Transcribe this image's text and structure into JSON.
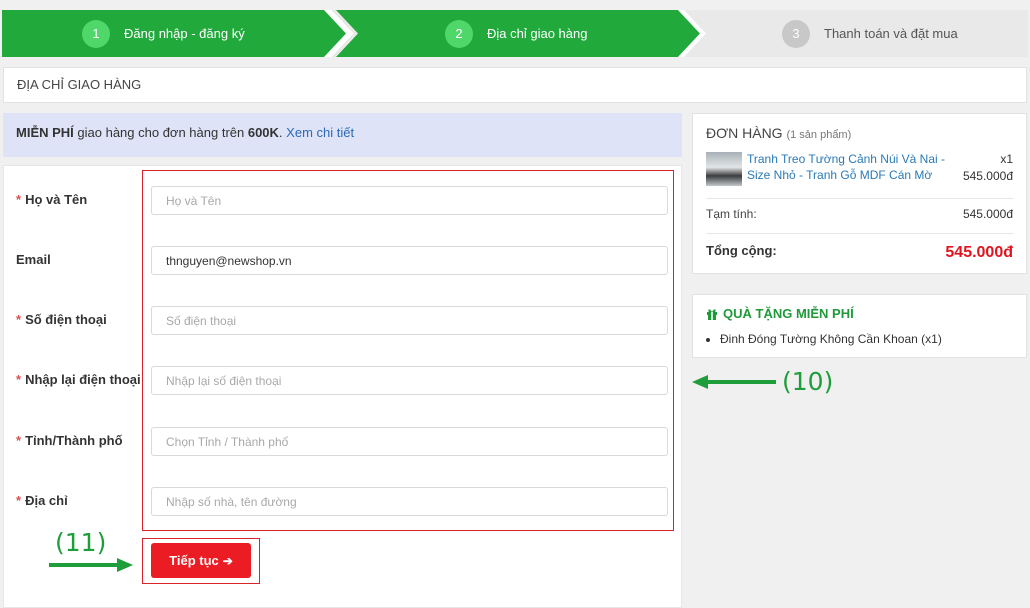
{
  "steps": [
    {
      "num": "1",
      "label": "Đăng nhập - đăng ký"
    },
    {
      "num": "2",
      "label": "Địa chỉ giao hàng"
    },
    {
      "num": "3",
      "label": "Thanh toán và đặt mua"
    }
  ],
  "section_title": "ĐỊA CHỈ GIAO HÀNG",
  "promo": {
    "free": "MIỄN PHÍ",
    "text": " giao hàng cho đơn hàng trên ",
    "amount": "600K",
    "dot": ".",
    "link": "Xem chi tiết"
  },
  "form": {
    "name_label": "Họ và Tên",
    "name_placeholder": "Họ và Tên",
    "email_label": "Email",
    "email_value": "thnguyen@newshop.vn",
    "phone_label": "Số điện thoại",
    "phone_placeholder": "Số điện thoại",
    "phone2_label": "Nhập lại điện thoại",
    "phone2_placeholder": "Nhập lại số điện thoại",
    "city_label": "Tỉnh/Thành phố",
    "city_placeholder": "Chọn Tỉnh / Thành phố",
    "address_label": "Địa chỉ",
    "address_placeholder": "Nhập số nhà, tên đường",
    "required_mark": "*"
  },
  "next_button": "Tiếp tục",
  "annotations": {
    "form": "(10)",
    "button": "(11)"
  },
  "order": {
    "title": "ĐƠN HÀNG",
    "count": "(1 sản phẩm)",
    "product_name": "Tranh Treo Tường Cảnh Núi Và Nai - Size Nhỏ - Tranh Gỗ MDF Cán Mờ",
    "qty": "x1",
    "price": "545.000đ",
    "subtotal_label": "Tạm tính:",
    "subtotal": "545.000đ",
    "total_label": "Tổng cộng:",
    "total": "545.000đ"
  },
  "gift": {
    "title": "QUÀ TẶNG MIỄN PHÍ",
    "item": "Đinh Đóng Tường Không Cần Khoan (x1)"
  },
  "colors": {
    "step_active": "#21a93c",
    "step_inactive": "#e9e9e9",
    "accent_red": "#ec1c24",
    "annotation_green": "#1e9e3a"
  },
  "icons": {
    "gift": "gift-icon",
    "next": "arrow-right-icon"
  }
}
